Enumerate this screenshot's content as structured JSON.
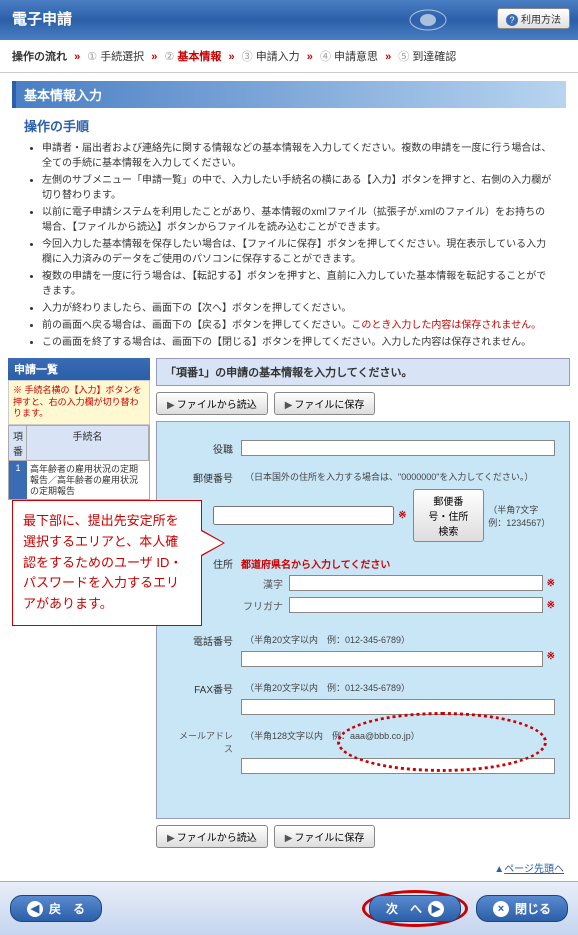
{
  "banner": {
    "title": "電子申請",
    "help": "利用方法"
  },
  "breadcrumb": {
    "label": "操作の流れ",
    "steps": [
      "手続選択",
      "基本情報",
      "申請入力",
      "申請意思",
      "到達確認"
    ],
    "current_idx": 1
  },
  "section_title": "基本情報入力",
  "procedure": {
    "title": "操作の手順",
    "items": [
      "申請者・届出者および連絡先に関する情報などの基本情報を入力してください。複数の申請を一度に行う場合は、全ての手続に基本情報を入力してください。",
      "左側のサブメニュー「申請一覧」の中で、入力したい手続名の横にある【入力】ボタンを押すと、右側の入力欄が切り替わります。",
      "以前に電子申請システムを利用したことがあり、基本情報のxmlファイル（拡張子が.xmlのファイル）をお持ちの場合、【ファイルから読込】ボタンからファイルを読み込むことができます。",
      "今回入力した基本情報を保存したい場合は、【ファイルに保存】ボタンを押してください。現在表示している入力欄に入力済みのデータをご使用のパソコンに保存することができます。",
      "複数の申請を一度に行う場合は、【転記する】ボタンを押すと、直前に入力していた基本情報を転記することができます。",
      "入力が終わりましたら、画面下の【次へ】ボタンを押してください。",
      "前の画面へ戻る場合は、画面下の【戻る】ボタンを押してください。",
      "この画面を終了する場合は、画面下の【閉じる】ボタンを押してください。入力した内容は保存されません。"
    ],
    "red_text": "このとき入力した内容は保存されません。"
  },
  "left_panel": {
    "head": "申請一覧",
    "note": "※ 手続名横の【入力】ボタンを押すと、右の入力欄が切り替わります。",
    "cols": [
      "項番",
      "手続名"
    ],
    "row": {
      "num": "1",
      "name": "高年齢者の雇用状況の定期報告／高年齢者の雇用状況の定期報告"
    }
  },
  "form": {
    "title": "「項番1」の申請の基本情報を入力してください。",
    "file_load": "ファイルから読込",
    "file_save": "ファイルに保存",
    "labels": {
      "yakushoku": "役職",
      "postal": "郵便番号",
      "postal_hint": "（日本国外の住所を入力する場合は、\"0000000\"を入力してください。）",
      "postal_search": "郵便番号・住所検索",
      "postal_ex": "（半角7文字　例：1234567）",
      "address": "住所",
      "address_hint": "都道府県名から入力してください",
      "kanji": "漢字",
      "furigana": "フリガナ",
      "tel": "電話番号",
      "tel_ex": "（半角20文字以内　例：012-345-6789）",
      "fax": "FAX番号",
      "fax_ex": "（半角20文字以内　例：012-345-6789）",
      "email": "メールアドレス",
      "email_ex": "（半角128文字以内　例：aaa@bbb.co.jp）"
    }
  },
  "callout": "最下部に、提出先安定所を選択するエリアと、本人確認をするためのユーザ ID・パスワードを入力するエリアがあります。",
  "page_top": "ページ先頭へ",
  "footer": {
    "back": "戻　る",
    "next": "次　へ",
    "close": "閉じる"
  }
}
